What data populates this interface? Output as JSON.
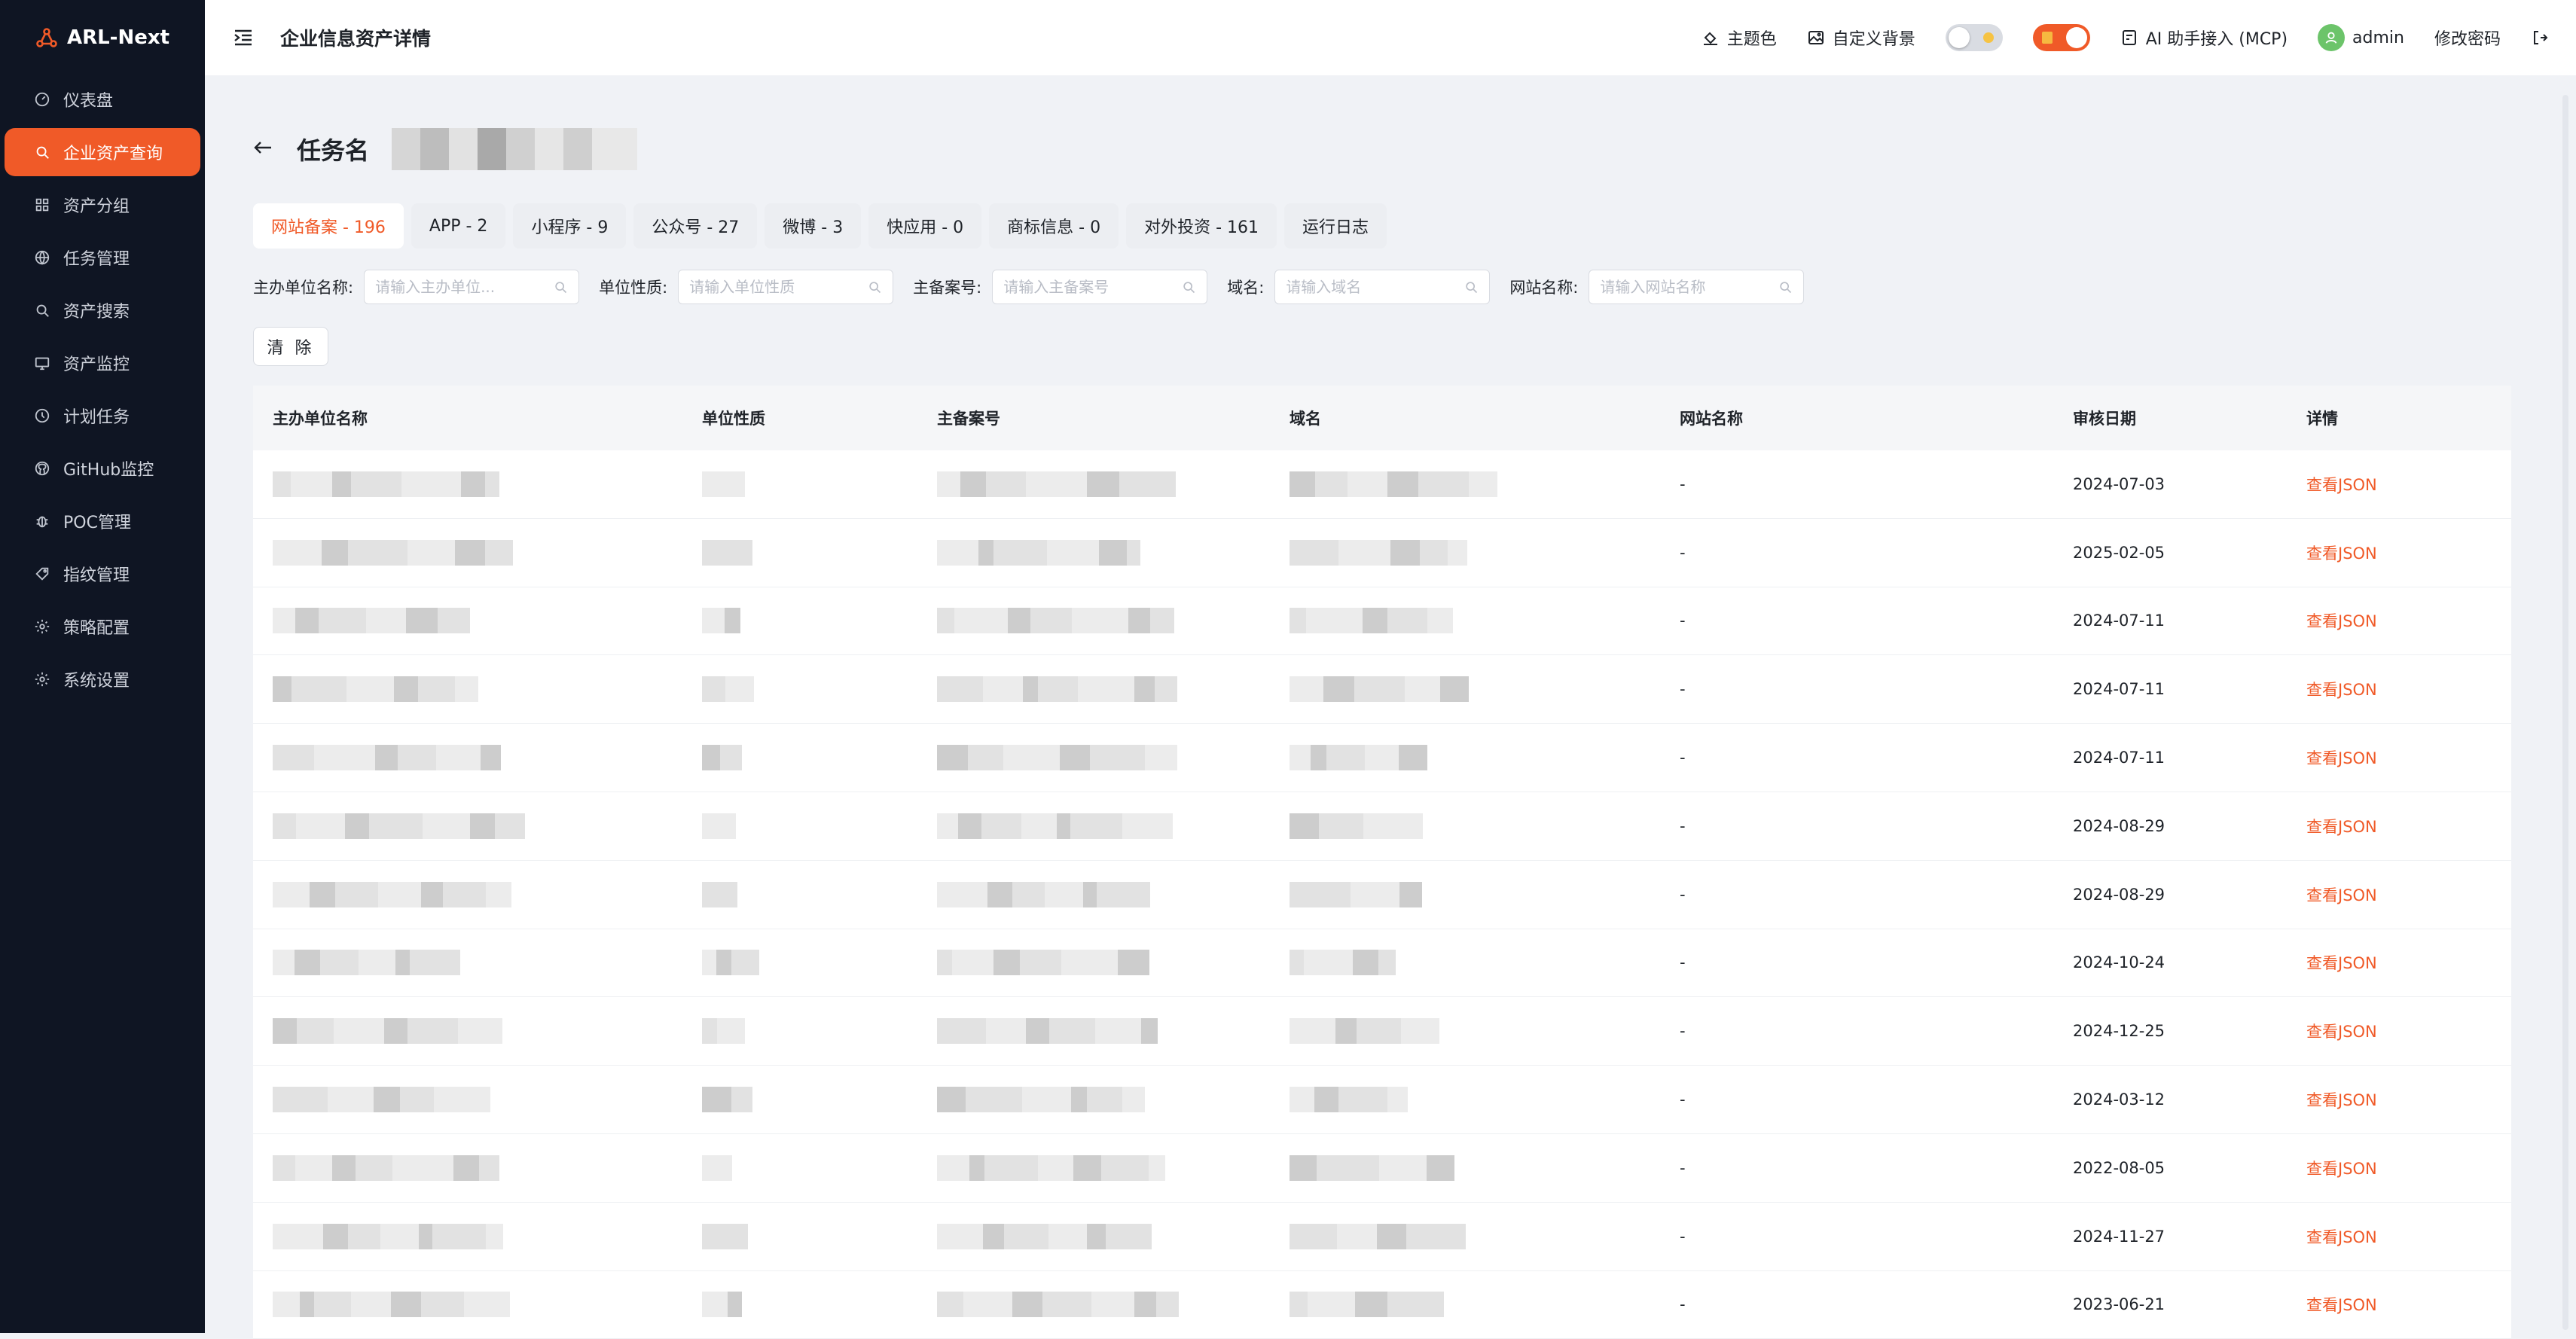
{
  "app": {
    "name": "ARL-Next"
  },
  "sidebar": {
    "items": [
      {
        "label": "仪表盘",
        "icon": "dashboard-icon",
        "active": false
      },
      {
        "label": "企业资产查询",
        "icon": "search-icon",
        "active": true
      },
      {
        "label": "资产分组",
        "icon": "grid-icon",
        "active": false
      },
      {
        "label": "任务管理",
        "icon": "globe-icon",
        "active": false
      },
      {
        "label": "资产搜索",
        "icon": "search-icon",
        "active": false
      },
      {
        "label": "资产监控",
        "icon": "monitor-icon",
        "active": false
      },
      {
        "label": "计划任务",
        "icon": "clock-icon",
        "active": false
      },
      {
        "label": "GitHub监控",
        "icon": "github-icon",
        "active": false
      },
      {
        "label": "POC管理",
        "icon": "bug-icon",
        "active": false
      },
      {
        "label": "指纹管理",
        "icon": "tag-icon",
        "active": false
      },
      {
        "label": "策略配置",
        "icon": "gear-icon",
        "active": false
      },
      {
        "label": "系统设置",
        "icon": "gear-icon",
        "active": false
      }
    ]
  },
  "header": {
    "title": "企业信息资产详情",
    "theme_color": "主题色",
    "custom_bg": "自定义背景",
    "ai_mcp": "AI 助手接入 (MCP)",
    "user": "admin",
    "change_password": "修改密码"
  },
  "task": {
    "title_prefix": "任务名"
  },
  "tabs": [
    {
      "label": "网站备案 - 196",
      "active": true
    },
    {
      "label": "APP - 2",
      "active": false
    },
    {
      "label": "小程序 - 9",
      "active": false
    },
    {
      "label": "公众号 - 27",
      "active": false
    },
    {
      "label": "微博 - 3",
      "active": false
    },
    {
      "label": "快应用 - 0",
      "active": false
    },
    {
      "label": "商标信息 - 0",
      "active": false
    },
    {
      "label": "对外投资 - 161",
      "active": false
    },
    {
      "label": "运行日志",
      "active": false
    }
  ],
  "filters": [
    {
      "label": "主办单位名称:",
      "placeholder": "请输入主办单位..."
    },
    {
      "label": "单位性质:",
      "placeholder": "请输入单位性质"
    },
    {
      "label": "主备案号:",
      "placeholder": "请输入主备案号"
    },
    {
      "label": "域名:",
      "placeholder": "请输入域名"
    },
    {
      "label": "网站名称:",
      "placeholder": "请输入网站名称"
    }
  ],
  "clear_label": "清 除",
  "table": {
    "columns": [
      "主办单位名称",
      "单位性质",
      "主备案号",
      "域名",
      "网站名称",
      "审核日期",
      "详情"
    ],
    "rows": [
      {
        "site_name": "-",
        "date": "2024-07-03",
        "action": "查看JSON"
      },
      {
        "site_name": "-",
        "date": "2025-02-05",
        "action": "查看JSON"
      },
      {
        "site_name": "-",
        "date": "2024-07-11",
        "action": "查看JSON"
      },
      {
        "site_name": "-",
        "date": "2024-07-11",
        "action": "查看JSON"
      },
      {
        "site_name": "-",
        "date": "2024-07-11",
        "action": "查看JSON"
      },
      {
        "site_name": "-",
        "date": "2024-08-29",
        "action": "查看JSON"
      },
      {
        "site_name": "-",
        "date": "2024-08-29",
        "action": "查看JSON"
      },
      {
        "site_name": "-",
        "date": "2024-10-24",
        "action": "查看JSON"
      },
      {
        "site_name": "-",
        "date": "2024-12-25",
        "action": "查看JSON"
      },
      {
        "site_name": "-",
        "date": "2024-03-12",
        "action": "查看JSON"
      },
      {
        "site_name": "-",
        "date": "2022-08-05",
        "action": "查看JSON"
      },
      {
        "site_name": "-",
        "date": "2024-11-27",
        "action": "查看JSON"
      },
      {
        "site_name": "-",
        "date": "2023-06-21",
        "action": "查看JSON"
      }
    ]
  },
  "colors": {
    "accent": "#f05a28",
    "sidebar_bg": "#0f1523"
  }
}
